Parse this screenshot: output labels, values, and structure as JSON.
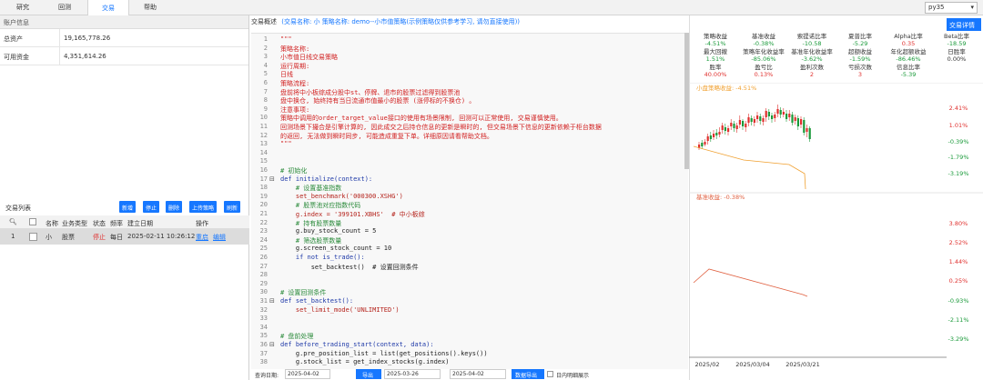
{
  "nav": {
    "tabs": [
      "研究",
      "回测",
      "交易",
      "帮助"
    ],
    "env": "py35"
  },
  "account": {
    "title": "账户信息",
    "rows": [
      {
        "k": "总资产",
        "v": "19,165,778.26"
      },
      {
        "k": "可用资金",
        "v": "4,351,614.26"
      }
    ]
  },
  "trade_list": {
    "title": "交易列表",
    "buttons": [
      "新增",
      "停止",
      "删除",
      "上传策略",
      "刷新"
    ],
    "headers": [
      "名称",
      "业务类型",
      "状态",
      "频率",
      "建立日期",
      "操作"
    ],
    "row": {
      "idx": "1",
      "name": "小",
      "type": "股票",
      "status": "停止",
      "freq": "每日",
      "date": "2025-02-11 10:26:12",
      "op1": "重启",
      "op2": "编辑"
    }
  },
  "editor": {
    "title": "交易概述",
    "meta": "(交易名称: 小   策略名称: demo--小市值策略(示例策略仅供参考学习, 请勿直接使用))"
  },
  "code_lines": [
    {
      "n": "1",
      "t": "\"\"\"",
      "c": "red"
    },
    {
      "n": "2",
      "t": "策略名称:",
      "c": "red"
    },
    {
      "n": "3",
      "t": "小市值日线交易策略",
      "c": "red"
    },
    {
      "n": "4",
      "t": "运行周期:",
      "c": "red"
    },
    {
      "n": "5",
      "t": "日线",
      "c": "red"
    },
    {
      "n": "6",
      "t": "策略流程:",
      "c": "red"
    },
    {
      "n": "7",
      "t": "盘前将中小板综成分股中st、停牌、退市的股票过滤得到股票池",
      "c": "red"
    },
    {
      "n": "8",
      "t": "盘中换仓, 始终持有当日流通市值最小的股票 (涨停标的不换仓) 。",
      "c": "red"
    },
    {
      "n": "9",
      "t": "注意事项:",
      "c": "red"
    },
    {
      "n": "10",
      "t": "策略中调用的order_target_value接口的使用有场景限制, 回测可以正常使用, 交易谨慎使用。",
      "c": "red"
    },
    {
      "n": "11",
      "t": "回测场景下撮合是引擎计算的, 因此成交之后持仓信息的更新是瞬时的, 但交易场景下信息的更新依赖于柜台数据",
      "c": "red"
    },
    {
      "n": "12",
      "t": "的返回, 无法做到瞬时同步, 可能造成重复下单。详细原因请看帮助文档。",
      "c": "red"
    },
    {
      "n": "13",
      "t": "\"\"\"",
      "c": "red"
    },
    {
      "n": "14",
      "t": "",
      "c": ""
    },
    {
      "n": "15",
      "t": "",
      "c": ""
    },
    {
      "n": "16",
      "t": "# 初始化",
      "c": "cm"
    },
    {
      "n": "17",
      "t": "def initialize(context):",
      "c": "kw"
    },
    {
      "n": "18",
      "t": "    # 设置基准指数",
      "c": "cm"
    },
    {
      "n": "19",
      "t": "    set_benchmark('000300.XSHG')",
      "c": "str"
    },
    {
      "n": "20",
      "t": "    # 股票池对应指数代码",
      "c": "cm"
    },
    {
      "n": "21",
      "t": "    g.index = '399101.XBHS'  # 中小板综",
      "c": "str"
    },
    {
      "n": "22",
      "t": "    # 持有股票数量",
      "c": "cm"
    },
    {
      "n": "23",
      "t": "    g.buy_stock_count = 5",
      "c": ""
    },
    {
      "n": "24",
      "t": "    # 筛选股票数量",
      "c": "cm"
    },
    {
      "n": "25",
      "t": "    g.screen_stock_count = 10",
      "c": ""
    },
    {
      "n": "26",
      "t": "    if not is_trade():",
      "c": "kw"
    },
    {
      "n": "27",
      "t": "        set_backtest()  # 设置回测条件",
      "c": ""
    },
    {
      "n": "28",
      "t": "",
      "c": ""
    },
    {
      "n": "29",
      "t": "",
      "c": ""
    },
    {
      "n": "30",
      "t": "# 设置回测条件",
      "c": "cm"
    },
    {
      "n": "31",
      "t": "def set_backtest():",
      "c": "kw"
    },
    {
      "n": "32",
      "t": "    set_limit_mode('UNLIMITED')",
      "c": "str"
    },
    {
      "n": "33",
      "t": "",
      "c": ""
    },
    {
      "n": "34",
      "t": "",
      "c": ""
    },
    {
      "n": "35",
      "t": "# 盘前处理",
      "c": "cm"
    },
    {
      "n": "36",
      "t": "def before_trading_start(context, data):",
      "c": "kw"
    },
    {
      "n": "37",
      "t": "    g.pre_position_list = list(get_positions().keys())",
      "c": ""
    },
    {
      "n": "38",
      "t": "    g.stock_list = get_index_stocks(g.index)",
      "c": ""
    }
  ],
  "bottom": {
    "label": "查询日期:",
    "d1": "2025-04-02",
    "d2": "2025-03-26",
    "d3": "2025-04-02",
    "export": "导出",
    "export2": "数据导出",
    "check": "日内明细展示"
  },
  "stats": {
    "detail_button": "交易详情",
    "row1": [
      {
        "label": "策略收益",
        "value": "-4.51%",
        "color": "g"
      },
      {
        "label": "基准收益",
        "value": "-0.38%",
        "color": "g"
      },
      {
        "label": "索提诺比率",
        "value": "-10.58",
        "color": "g"
      },
      {
        "label": "夏普比率",
        "value": "-5.29",
        "color": "g"
      },
      {
        "label": "Alpha比率",
        "value": "0.35",
        "color": "r"
      },
      {
        "label": "Beta比率",
        "value": "-18.59",
        "color": "g"
      }
    ],
    "row2": [
      {
        "label": "最大回撤",
        "value": "1.51%",
        "color": "g"
      },
      {
        "label": "策略年化收益率",
        "value": "-85.06%",
        "color": "g"
      },
      {
        "label": "基准年化收益率",
        "value": "-3.62%",
        "color": "g"
      },
      {
        "label": "超额收益",
        "value": "-1.59%",
        "color": "g"
      },
      {
        "label": "年化超额收益",
        "value": "-86.46%",
        "color": "g"
      },
      {
        "label": "日胜率",
        "value": "0.00%",
        "color": ""
      }
    ],
    "row3": [
      {
        "label": "胜率",
        "value": "40.00%",
        "color": "r"
      },
      {
        "label": "盈亏比",
        "value": "0.13%",
        "color": "r"
      },
      {
        "label": "盈利次数",
        "value": "2",
        "color": "r"
      },
      {
        "label": "亏损次数",
        "value": "3",
        "color": "r"
      },
      {
        "label": "信息比率",
        "value": "-5.39",
        "color": "g"
      }
    ]
  },
  "chart_data": [
    {
      "type": "candlestick",
      "title": "小盘策略收益: -4.51%",
      "y_ticks": [
        "2.41%",
        "1.01%",
        "-0.39%",
        "-1.79%",
        "-3.19%"
      ],
      "line_color": "#f0a030"
    },
    {
      "type": "line",
      "title": "基准收益: -0.38%",
      "y_ticks": [
        "3.80%",
        "2.52%",
        "1.44%",
        "0.25%",
        "-0.93%",
        "-2.11%",
        "-3.29%"
      ],
      "x_ticks": [
        "2025/02",
        "2025/03/04",
        "2025/03/21"
      ],
      "line_color": "#e06040"
    }
  ]
}
